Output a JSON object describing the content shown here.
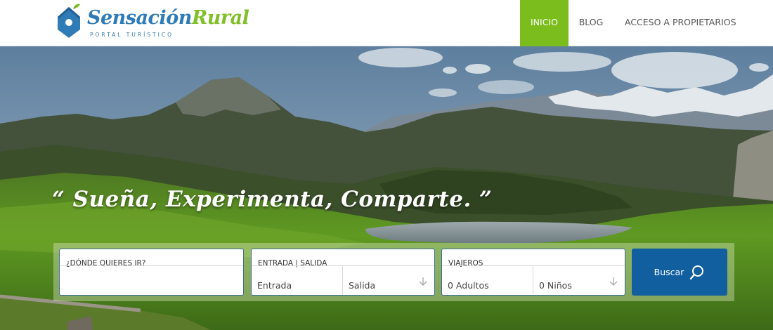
{
  "brand": {
    "name_part1": "Sensación",
    "name_part2": "Rural",
    "tagline": "PORTAL TURÍSTICO",
    "colors": {
      "blue": "#2f7bb6",
      "green": "#7fbf27"
    }
  },
  "nav": {
    "items": [
      {
        "label": "INICIO",
        "active": true
      },
      {
        "label": "BLOG",
        "active": false
      },
      {
        "label": "ACCESO A PROPIETARIOS",
        "active": false
      }
    ],
    "active_color": "#7cbd1e"
  },
  "hero": {
    "slogan": "“ Sueña, Experimenta, Comparte. ”"
  },
  "search": {
    "where_label": "¿DÓNDE QUIERES IR?",
    "where_value": "",
    "dates_label": "ENTRADA | SALIDA",
    "checkin": "Entrada",
    "checkout": "Salida",
    "travelers_label": "VIAJEROS",
    "adults": "0 Adultos",
    "children": "0 Niños",
    "button_label": "Buscar",
    "button_color": "#125fa0",
    "icons": [
      "house-logo-icon",
      "chevron-down-icon",
      "search-icon"
    ]
  }
}
